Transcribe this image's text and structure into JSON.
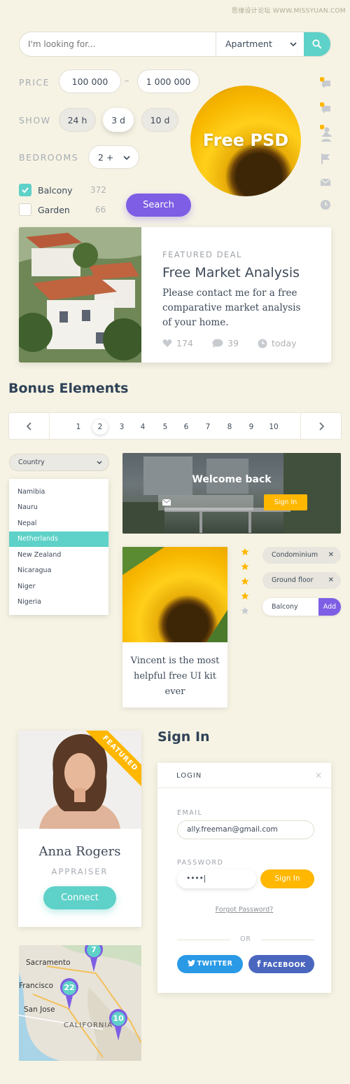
{
  "watermark": "思缘设计论坛 WWW.MISSYUAN.COM",
  "search": {
    "placeholder": "I'm looking for...",
    "type": "Apartment"
  },
  "filters": {
    "price_label": "PRICE",
    "price_min": "100 000",
    "price_sep": "–",
    "price_max": "1 000 000",
    "show_label": "SHOW",
    "show_options": [
      "24 h",
      "3 d",
      "10 d"
    ],
    "show_selected": "3 d",
    "bedrooms_label": "BEDROOMS",
    "bedrooms_value": "2 +",
    "amenities": [
      {
        "label": "Balcony",
        "count": "372",
        "checked": true
      },
      {
        "label": "Garden",
        "count": "66",
        "checked": false
      }
    ],
    "search_button": "Search"
  },
  "promo": {
    "text": "Free PSD"
  },
  "side_icons": [
    "chat-bubble-icon",
    "chat-bubble-icon",
    "user-icon",
    "user-icon",
    "flag-icon",
    "mail-icon",
    "clock-icon"
  ],
  "featured": {
    "kicker": "FEATURED DEAL",
    "title": "Free Market Analysis",
    "body": "Please contact me for a free comparative market analysis of your home.",
    "likes": "174",
    "comments": "39",
    "time": "today"
  },
  "bonus_title": "Bonus Elements",
  "pagination": {
    "pages": [
      "1",
      "2",
      "3",
      "4",
      "5",
      "6",
      "7",
      "8",
      "9",
      "10"
    ],
    "current": "2"
  },
  "country": {
    "label": "Country",
    "options": [
      "Namibia",
      "Nauru",
      "Nepal",
      "Netherlands",
      "New Zealand",
      "Nicaragua",
      "Niger",
      "Nigeria"
    ],
    "selected": "Netherlands"
  },
  "welcome": {
    "title": "Welcome back",
    "button": "Sign In"
  },
  "quote": {
    "text": "Vincent is the most helpful free UI kit ever"
  },
  "rating": {
    "value": 4,
    "max": 5
  },
  "tags": [
    "Condominium",
    "Ground floor"
  ],
  "tag_input": {
    "value": "Balcony",
    "button": "Add"
  },
  "profile": {
    "ribbon": "FEATURED",
    "name": "Anna Rogers",
    "role": "APPRAISER",
    "button": "Connect"
  },
  "signin": {
    "heading": "Sign In",
    "panel_title": "LOGIN",
    "email_label": "EMAIL",
    "email_value": "ally.freeman@gmail.com",
    "password_label": "PASSWORD",
    "password_value": "••••|",
    "submit": "Sign In",
    "forgot": "Forgot Password?",
    "or": "OR",
    "twitter": "TWITTER",
    "facebook": "FACEBOOK"
  },
  "map": {
    "cities": [
      "Sacramento",
      "Francisco",
      "San Jose",
      "CALIFORNIA"
    ],
    "pins": [
      "7",
      "22",
      "10"
    ]
  },
  "colors": {
    "teal": "#5ed1c8",
    "purple": "#7d5ee4",
    "yellow": "#ffb700",
    "background": "#f6f3e4"
  }
}
